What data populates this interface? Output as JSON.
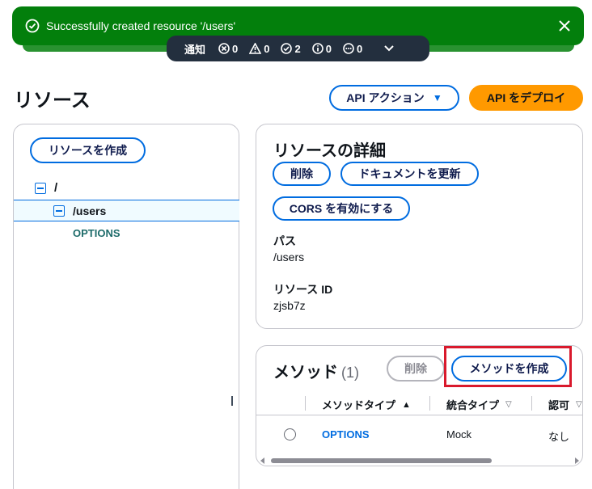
{
  "flash": {
    "message": "Successfully created resource '/users'"
  },
  "notifications": {
    "label": "通知",
    "errors": "0",
    "warnings": "0",
    "success": "2",
    "info": "0",
    "in_progress": "0"
  },
  "header": {
    "title": "リソース",
    "api_actions_label": "API アクション",
    "deploy_label": "API をデプロイ"
  },
  "tree": {
    "create_resource_label": "リソースを作成",
    "root": "/",
    "users": "/users",
    "options": "OPTIONS"
  },
  "details": {
    "title": "リソースの詳細",
    "delete_label": "削除",
    "update_doc_label": "ドキュメントを更新",
    "enable_cors_label": "CORS を有効にする",
    "path_label": "パス",
    "path_value": "/users",
    "resource_id_label": "リソース ID",
    "resource_id_value": "zjsb7z"
  },
  "methods": {
    "title": "メソッド",
    "count": "(1)",
    "delete_label": "削除",
    "create_label": "メソッドを作成",
    "columns": [
      "メソッドタイプ",
      "統合タイプ",
      "認可"
    ],
    "rows": [
      {
        "method": "OPTIONS",
        "integration": "Mock",
        "auth": "なし"
      }
    ]
  },
  "colors": {
    "success_green": "#037f0c",
    "link_blue": "#006ce0",
    "deploy_orange": "#ff9900",
    "highlight_red": "#d9192c"
  }
}
